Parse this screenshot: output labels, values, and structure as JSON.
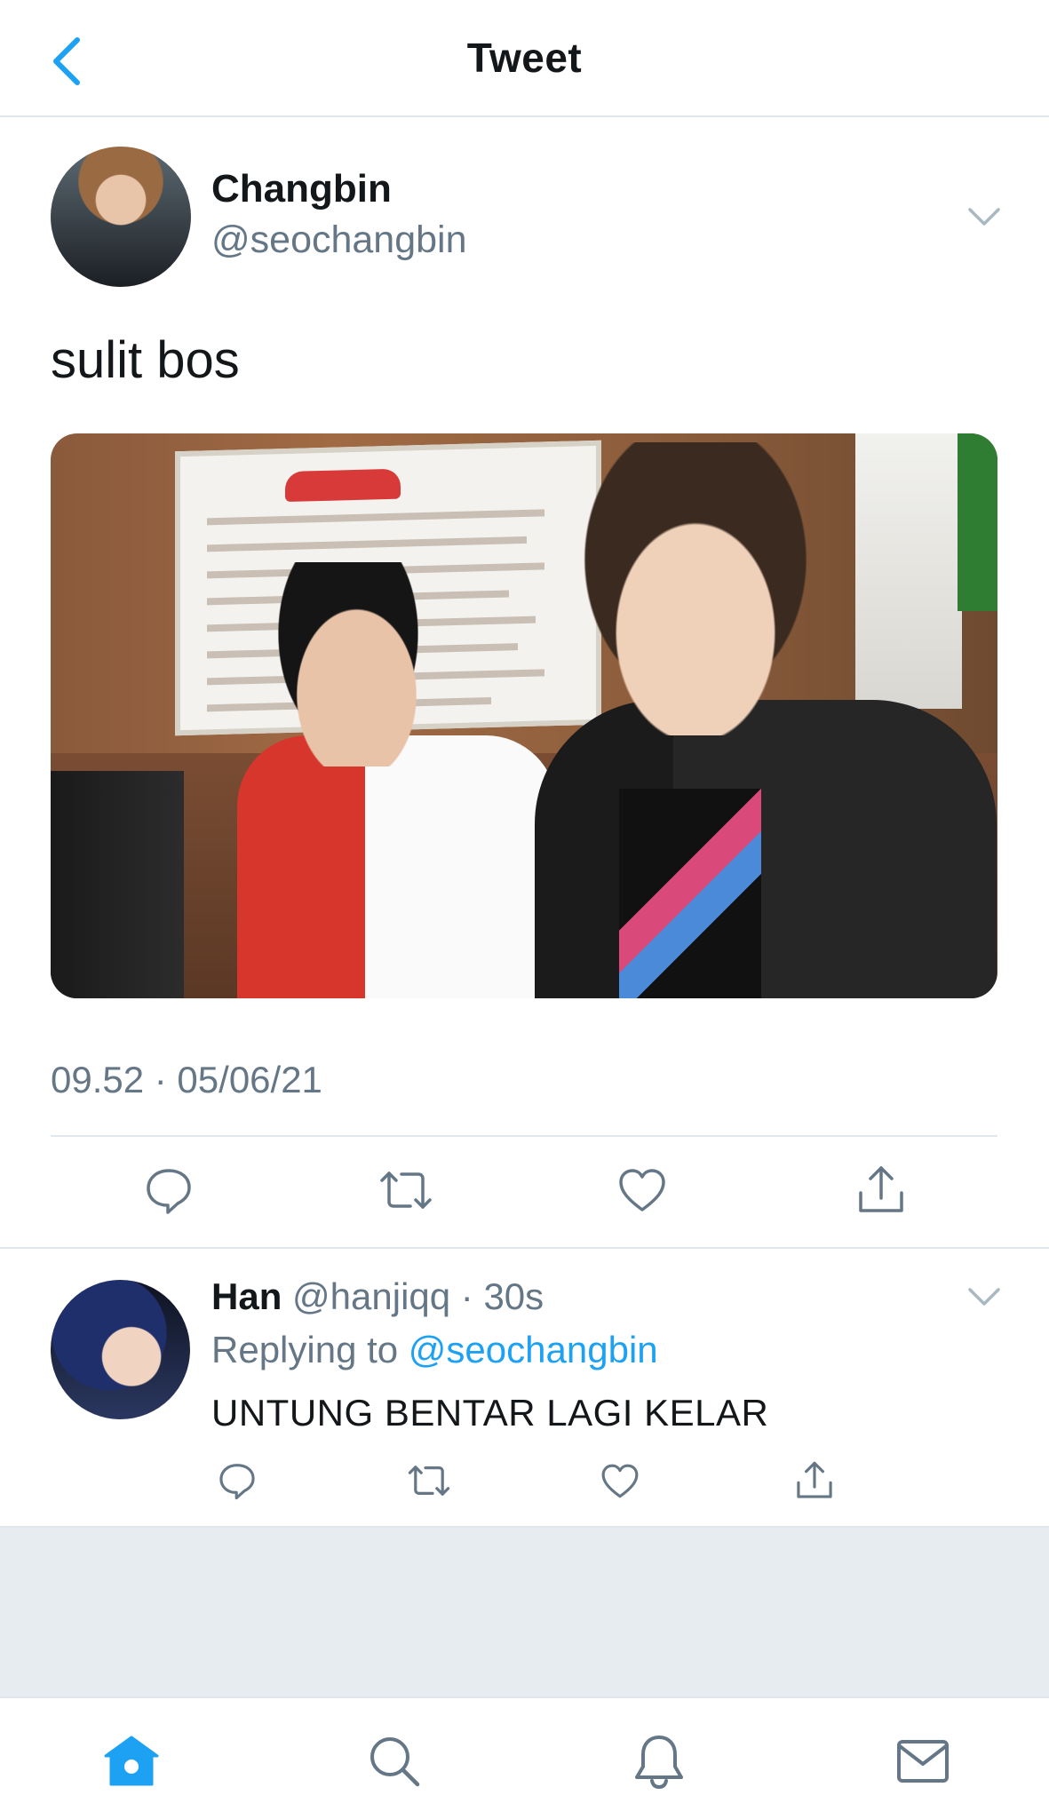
{
  "header": {
    "title": "Tweet"
  },
  "tweet": {
    "author_name": "Changbin",
    "author_handle": "@seochangbin",
    "text": "sulit bos",
    "timestamp": "09.52 · 05/06/21"
  },
  "reply": {
    "name": "Han",
    "handle": "@hanjiqq",
    "separator": " · ",
    "age": "30s",
    "replying_to_label": "Replying to",
    "replying_to_handle": "@seochangbin",
    "text": "UNTUNG BENTAR LAGI KELAR"
  },
  "colors": {
    "accent": "#1da1f2",
    "secondary_text": "#657786",
    "divider": "#e1e8ed",
    "gray_background": "#e6ecf0",
    "back_chevron": "#1da1f2",
    "home_tab_active": "#1da1f2"
  },
  "icons": {
    "back": "chevron-left-icon",
    "menu": "chevron-down-icon",
    "reply": "comment-icon",
    "retweet": "retweet-icon",
    "like": "heart-icon",
    "share": "share-icon",
    "tab_home": "home-icon",
    "tab_search": "search-icon",
    "tab_notifications": "bell-icon",
    "tab_messages": "mail-icon"
  }
}
